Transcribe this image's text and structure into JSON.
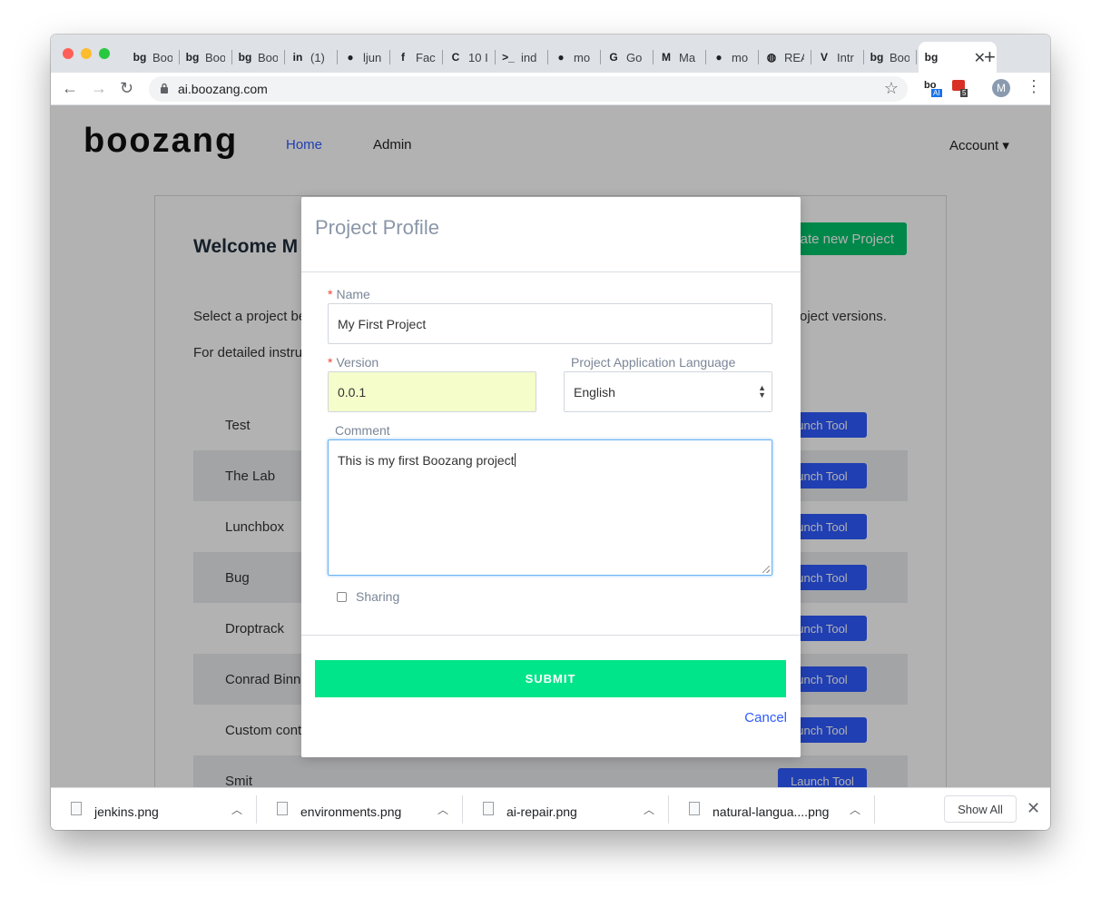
{
  "browser": {
    "tabs": [
      {
        "icon": "boozang-icon",
        "glyph": "bg",
        "title": "Boo"
      },
      {
        "icon": "boozang-icon",
        "glyph": "bg",
        "title": "Boo"
      },
      {
        "icon": "boozang-icon",
        "glyph": "bg",
        "title": "Boo"
      },
      {
        "icon": "linkedin-icon",
        "glyph": "in",
        "title": "(1)"
      },
      {
        "icon": "github-icon",
        "glyph": "●",
        "title": "ljun"
      },
      {
        "icon": "facebook-icon",
        "glyph": "f",
        "title": "Fac"
      },
      {
        "icon": "codebase-icon",
        "glyph": "C",
        "title": "10 I"
      },
      {
        "icon": "terminal-icon",
        "glyph": ">_",
        "title": "ind"
      },
      {
        "icon": "github-icon",
        "glyph": "●",
        "title": "mo"
      },
      {
        "icon": "translate-icon",
        "glyph": "G",
        "title": "Go"
      },
      {
        "icon": "markdown-icon",
        "glyph": "M",
        "title": "Ma"
      },
      {
        "icon": "github-icon",
        "glyph": "●",
        "title": "mo"
      },
      {
        "icon": "globe-icon",
        "glyph": "◍",
        "title": "REA"
      },
      {
        "icon": "vue-icon",
        "glyph": "V",
        "title": "Intr"
      },
      {
        "icon": "boozang-icon",
        "glyph": "bg",
        "title": "Boo"
      }
    ],
    "active_tab": {
      "glyph": "bg",
      "close": "✕"
    },
    "new_tab": "+",
    "url": "ai.boozang.com",
    "ext1": "bo",
    "ext1_badge": "AI",
    "ext2_badge": "5",
    "avatar": "M"
  },
  "app": {
    "logo": "boozang",
    "nav": {
      "home": "Home",
      "admin": "Admin",
      "account": "Account ▾"
    },
    "welcome": "Welcome M",
    "new_project": "ate new Project",
    "intro1": "Select a project be",
    "intro1_right": "roject versions.",
    "intro2": "For detailed instru",
    "launch_label": "unch Tool",
    "launch_full": "Launch Tool",
    "projects": [
      "Test",
      "The Lab",
      "Lunchbox",
      "Bug",
      "Droptrack",
      "Conrad Binne",
      "Custom cont",
      "Smit"
    ]
  },
  "modal": {
    "title": "Project Profile",
    "name_label": "Name",
    "name_value": "My First Project",
    "version_label": "Version",
    "version_value": "0.0.1",
    "language_label": "Project Application Language",
    "language_value": "English",
    "comment_label": "Comment",
    "comment_value": "This is my first Boozang project",
    "sharing_label": "Sharing",
    "submit": "SUBMIT",
    "cancel": "Cancel"
  },
  "downloads": {
    "files": [
      "jenkins.png",
      "environments.png",
      "ai-repair.png",
      "natural-langua....png"
    ],
    "show_all": "Show All"
  },
  "colors": {
    "submit": "#00e589",
    "new_project": "#00c36b",
    "launch": "#2e5bff",
    "version_bg": "#f5fdca"
  }
}
